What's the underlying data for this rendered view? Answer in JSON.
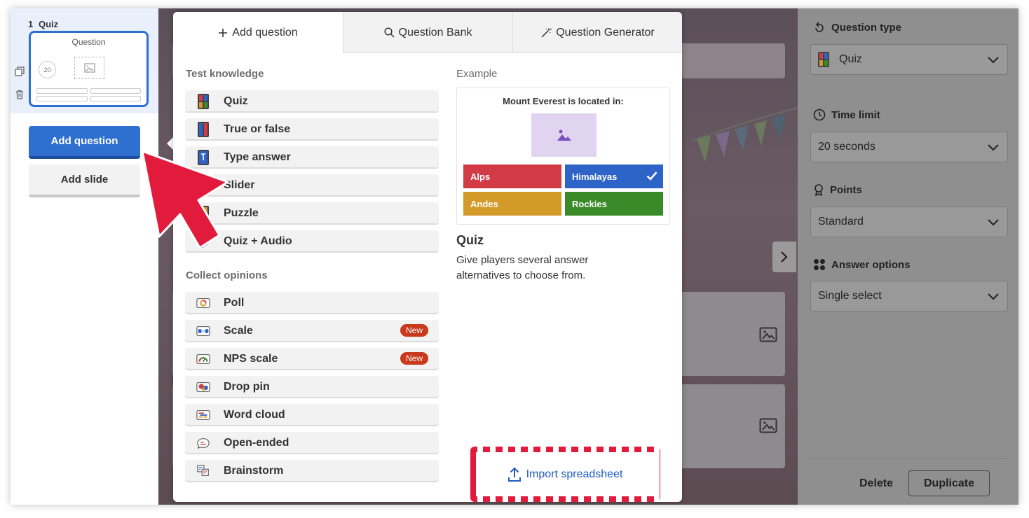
{
  "sidebar": {
    "slide_number": "1",
    "slide_type": "Quiz",
    "thumb_title": "Question",
    "thumb_timer": "20",
    "add_question": "Add question",
    "add_slide": "Add slide"
  },
  "modal": {
    "tabs": [
      {
        "label": "Add question",
        "icon": "plus-icon"
      },
      {
        "label": "Question Bank",
        "icon": "search-icon"
      },
      {
        "label": "Question Generator",
        "icon": "magic-wand-icon"
      }
    ],
    "sections": {
      "test_knowledge": "Test knowledge",
      "collect_opinions": "Collect opinions"
    },
    "knowledge_items": [
      {
        "label": "Quiz",
        "icon": "quiz-icon"
      },
      {
        "label": "True or false",
        "icon": "true-false-icon"
      },
      {
        "label": "Type answer",
        "icon": "type-answer-icon"
      },
      {
        "label": "Slider",
        "icon": "slider-icon"
      },
      {
        "label": "Puzzle",
        "icon": "puzzle-icon"
      },
      {
        "label": "Quiz + Audio",
        "icon": "audio-icon"
      }
    ],
    "opinion_items": [
      {
        "label": "Poll",
        "icon": "poll-icon",
        "badge": ""
      },
      {
        "label": "Scale",
        "icon": "scale-icon",
        "badge": "New"
      },
      {
        "label": "NPS scale",
        "icon": "nps-icon",
        "badge": "New"
      },
      {
        "label": "Drop pin",
        "icon": "drop-pin-icon",
        "badge": ""
      },
      {
        "label": "Word cloud",
        "icon": "word-cloud-icon",
        "badge": ""
      },
      {
        "label": "Open-ended",
        "icon": "open-ended-icon",
        "badge": ""
      },
      {
        "label": "Brainstorm",
        "icon": "brainstorm-icon",
        "badge": ""
      }
    ],
    "example": {
      "label": "Example",
      "question": "Mount Everest is located in:",
      "answers": [
        "Alps",
        "Himalayas",
        "Andes",
        "Rockies"
      ],
      "correct": "Himalayas",
      "title": "Quiz",
      "description": "Give players several answer alternatives to choose from."
    },
    "import_label": "Import spreadsheet"
  },
  "right_panel": {
    "question_type_label": "Question type",
    "question_type_value": "Quiz",
    "time_limit_label": "Time limit",
    "time_limit_value": "20 seconds",
    "points_label": "Points",
    "points_value": "Standard",
    "answer_options_label": "Answer options",
    "answer_options_value": "Single select",
    "delete_label": "Delete",
    "duplicate_label": "Duplicate"
  },
  "colors": {
    "accent": "#2f6fd0",
    "red": "#d23b45",
    "blue": "#2e63c7",
    "yellow": "#d39a2a",
    "green": "#3b8a2a",
    "arrow": "#e21b3c"
  }
}
